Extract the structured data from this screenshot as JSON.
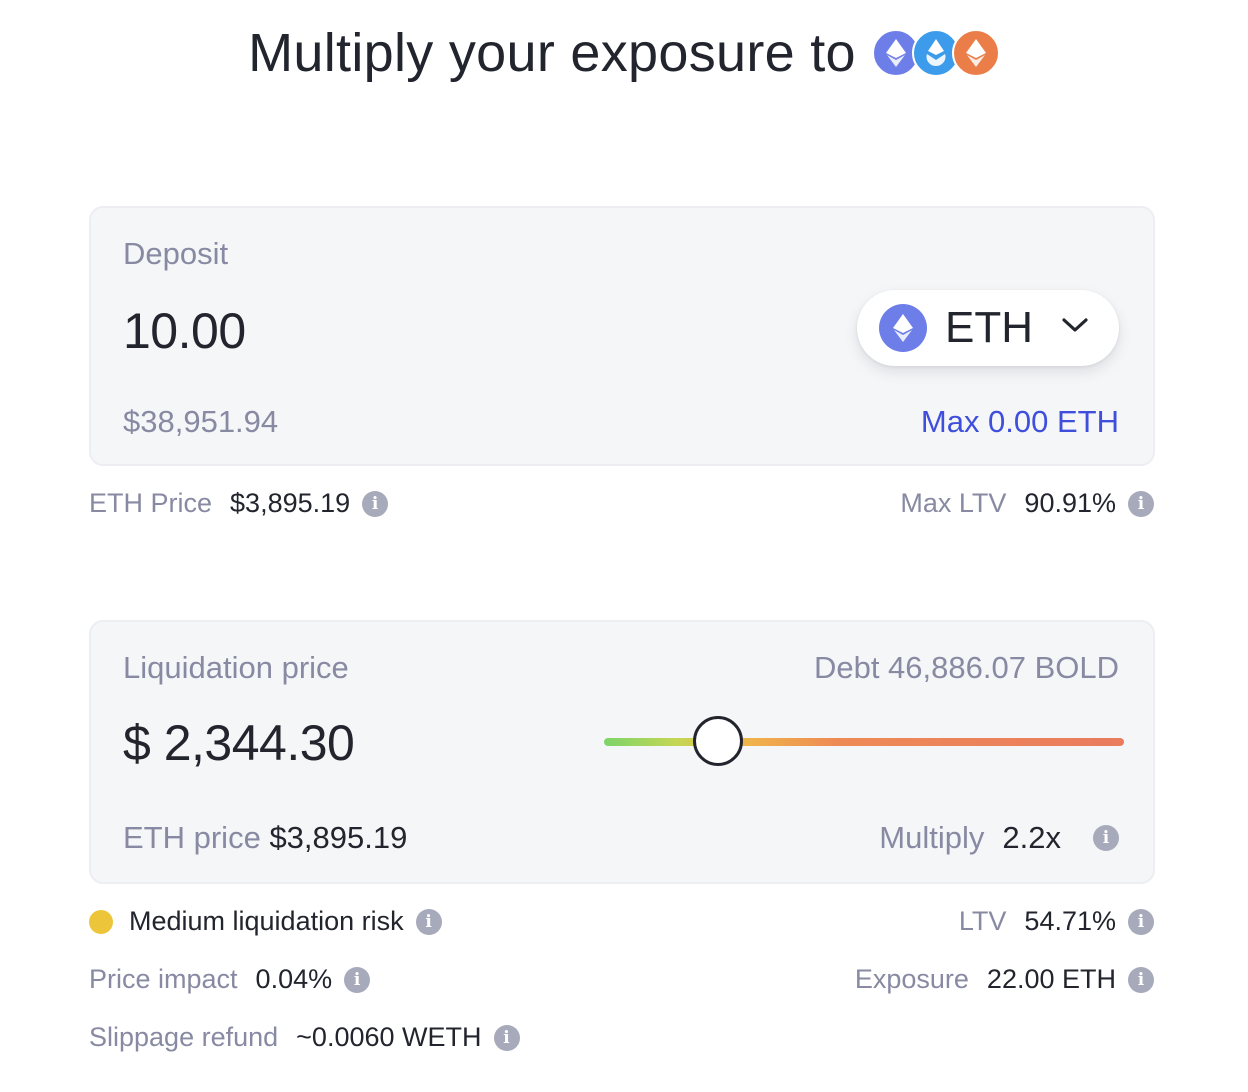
{
  "header": {
    "title": "Multiply your exposure to",
    "token_icons": [
      "eth-icon",
      "steth-icon",
      "reth-icon"
    ]
  },
  "deposit": {
    "label": "Deposit",
    "amount": "10.00",
    "usd_value": "$38,951.94",
    "token": "ETH",
    "max_label": "Max 0.00 ETH"
  },
  "deposit_info": {
    "eth_price_label": "ETH Price",
    "eth_price_value": "$3,895.19",
    "max_ltv_label": "Max LTV",
    "max_ltv_value": "90.91%"
  },
  "liquidation": {
    "label": "Liquidation price",
    "debt": "Debt 46,886.07 BOLD",
    "price": "$ 2,344.30",
    "eth_price_label": "ETH price",
    "eth_price_value": "$3,895.19",
    "multiply_label": "Multiply",
    "multiply_value": "2.2x",
    "slider_position": 0.22
  },
  "details": {
    "risk_label": "Medium liquidation risk",
    "ltv_label": "LTV",
    "ltv_value": "54.71%",
    "price_impact_label": "Price impact",
    "price_impact_value": "0.04%",
    "exposure_label": "Exposure",
    "exposure_value": "22.00 ETH",
    "slippage_label": "Slippage refund",
    "slippage_value": "~0.0060 WETH"
  },
  "colors": {
    "accent": "#3f4fdc",
    "risk_medium": "#ecc53b",
    "text": "#22252d",
    "muted": "#878aa2"
  }
}
